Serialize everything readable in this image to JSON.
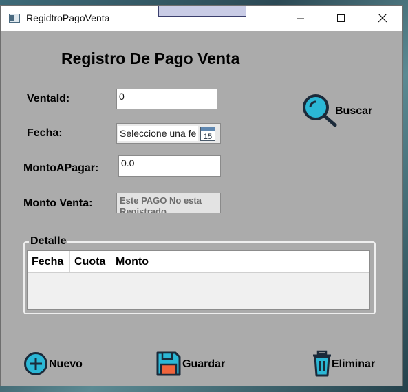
{
  "window": {
    "title": "RegidtroPagoVenta"
  },
  "form": {
    "heading": "Registro De Pago Venta",
    "venta_id": {
      "label": "VentaId:",
      "value": "0"
    },
    "fecha": {
      "label": "Fecha:",
      "placeholder": "Seleccione una fe",
      "calendar_day": "15"
    },
    "monto_a_pagar": {
      "label": "MontoAPagar:",
      "value": "0.0"
    },
    "monto_venta": {
      "label": "Monto Venta:",
      "value": "Este PAGO No esta Registrado"
    },
    "buscar_label": "Buscar"
  },
  "detalle": {
    "title": "Detalle",
    "columns": [
      "Fecha",
      "Cuota",
      "Monto"
    ]
  },
  "actions": {
    "nuevo": "Nuevo",
    "guardar": "Guardar",
    "eliminar": "Eliminar"
  },
  "colors": {
    "icon_fill": "#2bb7d6",
    "icon_stroke": "#1b2a3a",
    "save_accent": "#f0643c"
  }
}
